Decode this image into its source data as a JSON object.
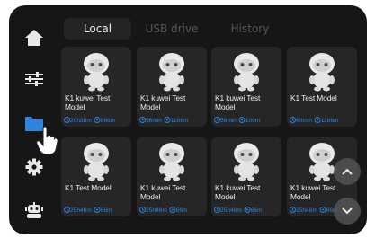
{
  "tabs": [
    {
      "label": "Local",
      "active": true
    },
    {
      "label": "USB drive",
      "active": false
    },
    {
      "label": "History",
      "active": false
    }
  ],
  "sidebar": {
    "items": [
      {
        "icon": "home-icon"
      },
      {
        "icon": "sliders-icon"
      },
      {
        "icon": "folder-icon",
        "active": true,
        "accent": "#2f84e0"
      },
      {
        "icon": "gear-icon"
      },
      {
        "icon": "robot-icon"
      }
    ]
  },
  "files": [
    {
      "name": "K1 kuwei Test Model",
      "time": "20h38m",
      "length": "866m"
    },
    {
      "name": "K1 kuwei Test Model",
      "time": "56min",
      "length": "1166m"
    },
    {
      "name": "K1 kuwei Test Model",
      "time": "56min",
      "length": "100m"
    },
    {
      "name": "K1 Test Model",
      "time": "60min",
      "length": "1166m"
    },
    {
      "name": "K1 Test Model",
      "time": "25h46m",
      "length": "66m"
    },
    {
      "name": "K1 kuwei Test Model",
      "time": "25h46m",
      "length": "66m"
    },
    {
      "name": "K1 kuwei Test Model",
      "time": "25h46m",
      "length": "66m"
    },
    {
      "name": "K1 kuwei Test Model",
      "time": "25h46m",
      "length": "66m"
    }
  ],
  "scroll": {
    "up_icon": "chevron-up-icon",
    "down_icon": "chevron-down-icon"
  },
  "colors": {
    "accent": "#2f84e0",
    "background": "#161616",
    "card": "#262626"
  }
}
